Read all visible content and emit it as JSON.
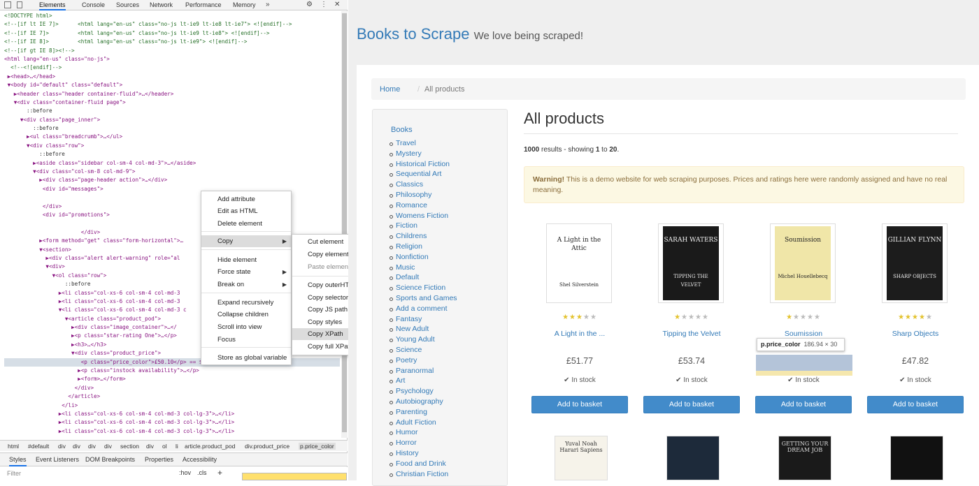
{
  "devtools": {
    "tabs": [
      "Elements",
      "Console",
      "Sources",
      "Network",
      "Performance",
      "Memory"
    ],
    "code_lines": [
      {
        "c": "<!DOCTYPE html>",
        "k": "c"
      },
      {
        "c": "<!--[if lt IE 7]>      <html lang=\"en-us\" class=\"no-js lt-ie9 lt-ie8 lt-ie7\"> <![endif]-->",
        "k": "c"
      },
      {
        "c": "<!--[if IE 7]>         <html lang=\"en-us\" class=\"no-js lt-ie9 lt-ie8\"> <![endif]-->",
        "k": "c"
      },
      {
        "c": "<!--[if IE 8]>         <html lang=\"en-us\" class=\"no-js lt-ie9\"> <![endif]-->",
        "k": "c"
      },
      {
        "c": "<!--[if gt IE 8]><!-->",
        "k": "c"
      },
      {
        "c": "<html lang=\"en-us\" class=\"no-js\">",
        "k": "t"
      },
      {
        "c": "  <!--<![endif]-->",
        "k": "c"
      },
      {
        "c": " ▶<head>…</head>",
        "k": "t"
      },
      {
        "c": " ▼<body id=\"default\" class=\"default\">",
        "k": "t"
      },
      {
        "c": "   ▶<header class=\"header container-fluid\">…</header>",
        "k": "t"
      },
      {
        "c": "   ▼<div class=\"container-fluid page\">",
        "k": "t"
      },
      {
        "c": "       ::before",
        "k": "p"
      },
      {
        "c": "     ▼<div class=\"page_inner\">",
        "k": "t"
      },
      {
        "c": "         ::before",
        "k": "p"
      },
      {
        "c": "       ▶<ul class=\"breadcrumb\">…</ul>",
        "k": "t"
      },
      {
        "c": "       ▼<div class=\"row\">",
        "k": "t"
      },
      {
        "c": "           ::before",
        "k": "p"
      },
      {
        "c": "         ▶<aside class=\"sidebar col-sm-4 col-md-3\">…</aside>",
        "k": "t"
      },
      {
        "c": "         ▼<div class=\"col-sm-8 col-md-9\">",
        "k": "t"
      },
      {
        "c": "           ▶<div class=\"page-header action\">…</div>",
        "k": "t"
      },
      {
        "c": "            <div id=\"messages\">",
        "k": "t"
      },
      {
        "c": "",
        "k": "p"
      },
      {
        "c": "            </div>",
        "k": "t"
      },
      {
        "c": "            <div id=\"promotions\">",
        "k": "t"
      },
      {
        "c": "",
        "k": "p"
      },
      {
        "c": "                        </div>",
        "k": "t"
      },
      {
        "c": "           ▶<form method=\"get\" class=\"form-horizontal\">…",
        "k": "t"
      },
      {
        "c": "           ▼<section>",
        "k": "t"
      },
      {
        "c": "             ▶<div class=\"alert alert-warning\" role=\"al",
        "k": "t"
      },
      {
        "c": "             ▼<div>",
        "k": "t"
      },
      {
        "c": "               ▼<ol class=\"row\">",
        "k": "t"
      },
      {
        "c": "                   ::before",
        "k": "p"
      },
      {
        "c": "                 ▶<li class=\"col-xs-6 col-sm-4 col-md-3",
        "k": "t"
      },
      {
        "c": "                 ▶<li class=\"col-xs-6 col-sm-4 col-md-3",
        "k": "t"
      },
      {
        "c": "                 ▼<li class=\"col-xs-6 col-sm-4 col-md-3 c",
        "k": "t"
      },
      {
        "c": "                   ▼<article class=\"product_pod\">",
        "k": "t"
      },
      {
        "c": "                     ▶<div class=\"image_container\">…</",
        "k": "t"
      },
      {
        "c": "                     ▶<p class=\"star-rating One\">…</p>",
        "k": "t"
      },
      {
        "c": "                     ▶<h3>…</h3>",
        "k": "t"
      },
      {
        "c": "                     ▼<div class=\"product_price\">",
        "k": "t"
      },
      {
        "c": "                        <p class=\"price_color\">£50.10</p> == $0",
        "k": "s"
      },
      {
        "c": "                       ▶<p class=\"instock availability\">…</p>",
        "k": "t"
      },
      {
        "c": "                       ▶<form>…</form>",
        "k": "t"
      },
      {
        "c": "                      </div>",
        "k": "t"
      },
      {
        "c": "                    </article>",
        "k": "t"
      },
      {
        "c": "                  </li>",
        "k": "t"
      },
      {
        "c": "                 ▶<li class=\"col-xs-6 col-sm-4 col-md-3 col-lg-3\">…</li>",
        "k": "t"
      },
      {
        "c": "                 ▶<li class=\"col-xs-6 col-sm-4 col-md-3 col-lg-3\">…</li>",
        "k": "t"
      },
      {
        "c": "                 ▶<li class=\"col-xs-6 col-sm-4 col-md-3 col-lg-3\">…</li>",
        "k": "t"
      }
    ],
    "breadcrumb": [
      "html",
      "#default",
      "div",
      "div",
      "div",
      "div",
      "section",
      "div",
      "ol",
      "li",
      "article.product_pod",
      "div.product_price",
      "p.price_color"
    ],
    "subtabs": [
      "Styles",
      "Event Listeners",
      "DOM Breakpoints",
      "Properties",
      "Accessibility"
    ],
    "filter_placeholder": "Filter",
    "hov": ":hov",
    "cls": ".cls",
    "plus": "+"
  },
  "context_menu": {
    "items": [
      "Add attribute",
      "Edit as HTML",
      "Delete element",
      "Copy",
      "Hide element",
      "Force state",
      "Break on",
      "Expand recursively",
      "Collapse children",
      "Scroll into view",
      "Focus",
      "Store as global variable"
    ],
    "submenu": [
      "Cut element",
      "Copy element",
      "Paste element",
      "Copy outerHTML",
      "Copy selector",
      "Copy JS path",
      "Copy styles",
      "Copy XPath",
      "Copy full XPath"
    ]
  },
  "site": {
    "brand": "Books to Scrape",
    "tagline": "We love being scraped!",
    "breadcrumb_home": "Home",
    "breadcrumb_sep": "/",
    "breadcrumb_current": "All products",
    "sidebar_title": "Books",
    "categories": [
      "Travel",
      "Mystery",
      "Historical Fiction",
      "Sequential Art",
      "Classics",
      "Philosophy",
      "Romance",
      "Womens Fiction",
      "Fiction",
      "Childrens",
      "Religion",
      "Nonfiction",
      "Music",
      "Default",
      "Science Fiction",
      "Sports and Games",
      "Add a comment",
      "Fantasy",
      "New Adult",
      "Young Adult",
      "Science",
      "Poetry",
      "Paranormal",
      "Art",
      "Psychology",
      "Autobiography",
      "Parenting",
      "Adult Fiction",
      "Humor",
      "Horror",
      "History",
      "Food and Drink",
      "Christian Fiction"
    ],
    "heading": "All products",
    "results_count": "1000",
    "results_mid": " results - showing ",
    "results_from": "1",
    "results_to_word": " to ",
    "results_to": "20",
    "results_end": ".",
    "alert_strong": "Warning!",
    "alert_text": " This is a demo website for web scraping purposes. Prices and ratings here were randomly assigned and have no real meaning.",
    "products": [
      {
        "name": "A Light in the ...",
        "price": "£51.77",
        "stock": "In stock",
        "rating": 3,
        "cover_title": "A Light in the Attic",
        "cover_author": "Shel Silverstein",
        "cover_bg": "#ffffff"
      },
      {
        "name": "Tipping the Velvet",
        "price": "£53.74",
        "stock": "In stock",
        "rating": 1,
        "cover_title": "SARAH WATERS",
        "cover_author": "TIPPING THE VELVET",
        "cover_bg": "#1a1a1a"
      },
      {
        "name": "Soumission",
        "price": "£50.10",
        "stock": "In stock",
        "rating": 1,
        "cover_title": "Soumission",
        "cover_author": "Michel Houellebecq",
        "cover_bg": "#f0e6a8"
      },
      {
        "name": "Sharp Objects",
        "price": "£47.82",
        "stock": "In stock",
        "rating": 4,
        "cover_title": "GILLIAN FLYNN",
        "cover_author": "SHARP OBJECTS",
        "cover_bg": "#1c1c1c"
      }
    ],
    "add_label": "Add to basket",
    "second_row": [
      "Yuval Noah Harari Sapiens",
      "",
      "GETTING YOUR DREAM JOB",
      ""
    ],
    "tooltip_tag": "p.price_color",
    "tooltip_dim": "186.94 × 30"
  },
  "colors": {
    "accent": "#337ab7",
    "button": "#428bca",
    "star": "#e3c22d"
  }
}
